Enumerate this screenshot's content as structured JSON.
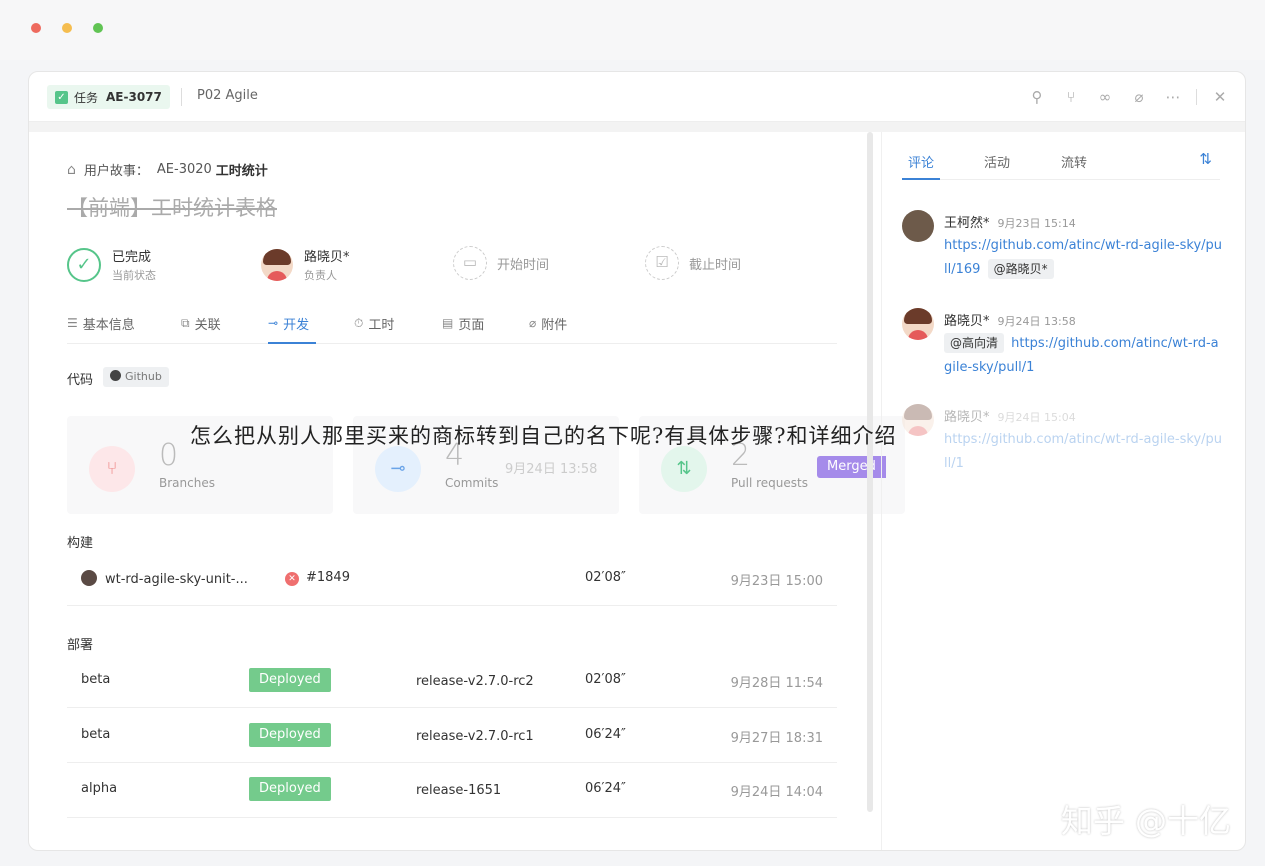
{
  "header": {
    "task_type": "任务",
    "task_id": "AE-3077",
    "project": "P02 Agile",
    "icons": [
      "pin-icon",
      "branch-icon",
      "link-icon",
      "attachment-icon",
      "more-icon",
      "close-icon"
    ]
  },
  "breadcrumb": {
    "type": "用户故事：",
    "id": "AE-3020",
    "title": "工时统计"
  },
  "title": "【前端】工时统计表格",
  "props": {
    "status_value": "已完成",
    "status_label": "当前状态",
    "owner_value": "路晓贝*",
    "owner_label": "负责人",
    "start_label": "开始时间",
    "end_label": "截止时间"
  },
  "tabs": [
    {
      "label": "基本信息",
      "icon": "list-icon"
    },
    {
      "label": "关联",
      "icon": "relation-icon"
    },
    {
      "label": "开发",
      "icon": "commit-icon",
      "active": true
    },
    {
      "label": "工时",
      "icon": "stopwatch-icon"
    },
    {
      "label": "页面",
      "icon": "page-icon"
    },
    {
      "label": "附件",
      "icon": "attachment-icon"
    }
  ],
  "code": {
    "label": "代码",
    "badge": "Github",
    "stats": [
      {
        "num": "0",
        "label": "Branches"
      },
      {
        "num": "4",
        "label": "Commits",
        "date": "9月24日 13:58"
      },
      {
        "num": "2",
        "label": "Pull requests",
        "badge": "Merged"
      }
    ]
  },
  "build": {
    "label": "构建",
    "rows": [
      {
        "name": "wt-rd-agile-sky-unit-...",
        "number": "#1849",
        "duration": "02′08″",
        "time": "9月23日 15:00"
      }
    ]
  },
  "deploy": {
    "label": "部署",
    "rows": [
      {
        "env": "beta",
        "status": "Deployed",
        "release": "release-v2.7.0-rc2",
        "duration": "02′08″",
        "time": "9月28日 11:54"
      },
      {
        "env": "beta",
        "status": "Deployed",
        "release": "release-v2.7.0-rc1",
        "duration": "06′24″",
        "time": "9月27日 18:31"
      },
      {
        "env": "alpha",
        "status": "Deployed",
        "release": "release-1651",
        "duration": "06′24″",
        "time": "9月24日 14:04"
      }
    ]
  },
  "right_tabs": [
    "评论",
    "活动",
    "流转"
  ],
  "comments": [
    {
      "author": "王柯然*",
      "time": "9月23日 15:14",
      "link": "https://github.com/atinc/wt-rd-agile-sky/pull/169",
      "mention": "@路晓贝*"
    },
    {
      "author": "路晓贝*",
      "time": "9月24日 13:58",
      "mention": "@高向清",
      "link": "https://github.com/atinc/wt-rd-agile-sky/pull/1"
    },
    {
      "author": "路晓贝*",
      "time": "9月24日 15:04",
      "link": "https://github.com/atinc/wt-rd-agile-sky/pull/1"
    }
  ],
  "overlay": "怎么把从别人那里买来的商标转到自己的名下呢?有具体步骤?和详细介绍",
  "watermark": "知乎 @十亿",
  "colors": {
    "accent": "#3b82d6",
    "done": "#56c58a",
    "deployed": "#74cb8c",
    "merged": "#a58bea",
    "fail": "#ef6f6f"
  }
}
